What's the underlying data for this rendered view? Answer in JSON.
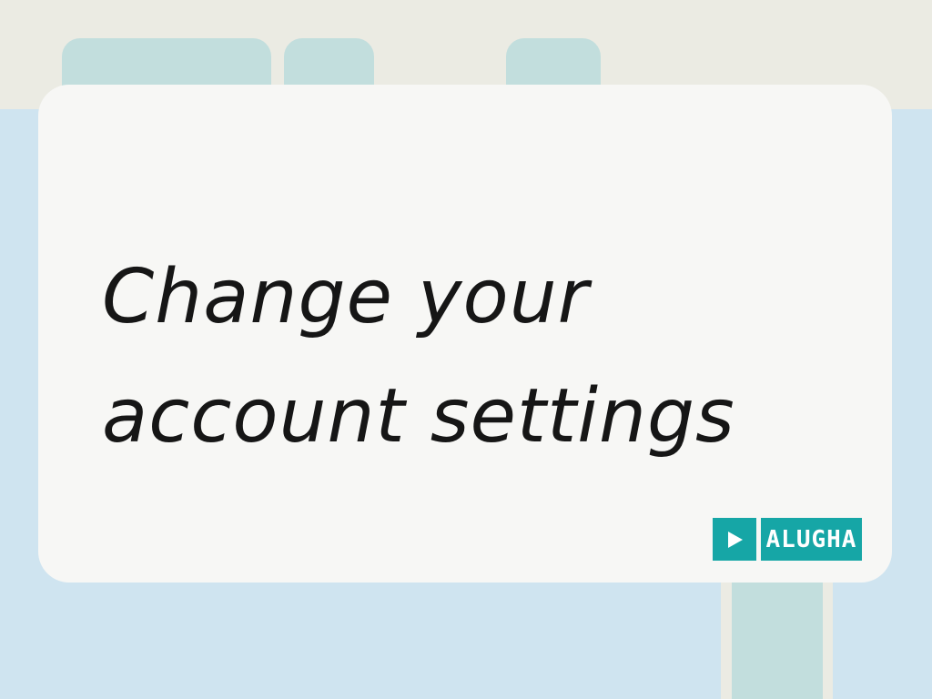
{
  "slide": {
    "title_lines": [
      "Change your",
      "account settings"
    ]
  },
  "brand": {
    "logo_text": "ALUGHA",
    "accent_color": "#16a6a6"
  },
  "colors": {
    "background": "#cfe4f0",
    "top_band": "#ebebe3",
    "tabs": "#c2dedd",
    "card": "#f7f7f5",
    "text": "#161616"
  },
  "icons": [
    "play-icon"
  ]
}
